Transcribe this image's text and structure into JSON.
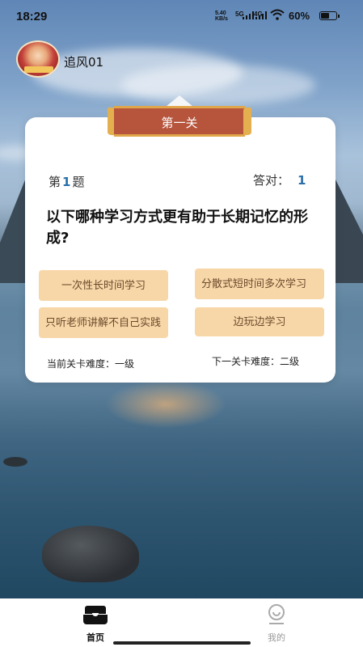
{
  "status_bar": {
    "time": "18:29",
    "net_speed_value": "5.40",
    "net_speed_unit": "KB/s",
    "signal1": "5G",
    "signal2": "4G",
    "battery": "60%",
    "battery_level": 0.6
  },
  "user": {
    "name": "追风01"
  },
  "level": {
    "title": "第一关"
  },
  "quiz": {
    "question_prefix": "第",
    "question_number": "1",
    "question_suffix": "题",
    "correct_label": "答对：",
    "correct_count": "1",
    "question": "以下哪种学习方式更有助于长期记忆的形成?",
    "options": [
      {
        "text": "一次性长时间学习"
      },
      {
        "text": "分散式短时间多次学习"
      },
      {
        "text": "只听老师讲解不自己实践"
      },
      {
        "text": "边玩边学习"
      }
    ],
    "current_difficulty": "当前关卡难度：一级",
    "next_difficulty": "下一关卡难度：二级"
  },
  "tabbar": {
    "items": [
      {
        "label": "首页",
        "icon": "home-icon",
        "active": true
      },
      {
        "label": "我的",
        "icon": "profile-icon",
        "active": false
      }
    ]
  }
}
